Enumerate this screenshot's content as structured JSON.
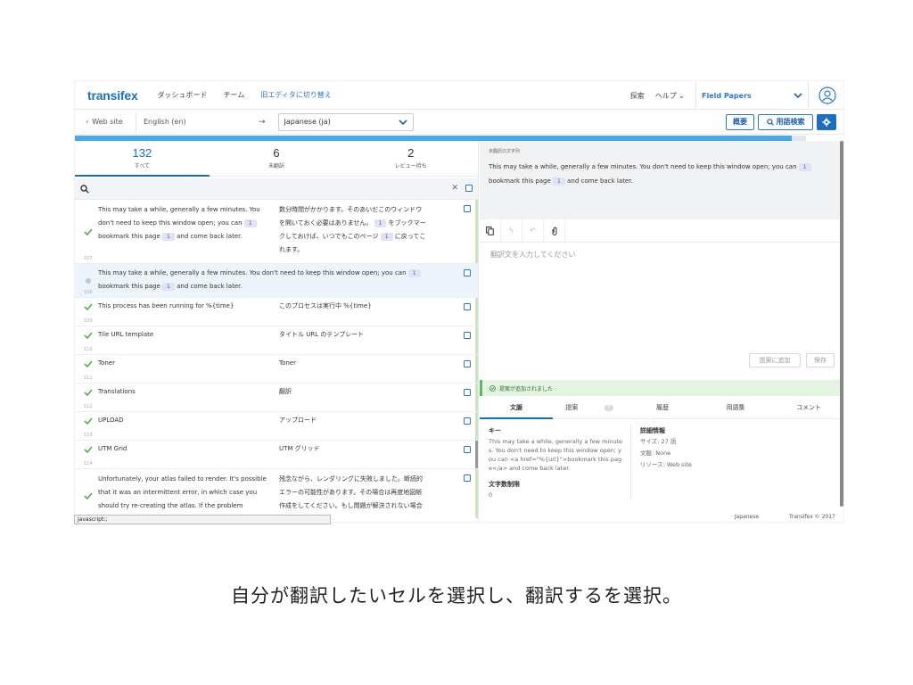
{
  "nav": {
    "logo": "transifex",
    "links": [
      "ダッシュボード",
      "チーム"
    ],
    "legacy_editor": "旧エディタに切り替え",
    "search": "探索",
    "help": "ヘルプ",
    "project": "Field Papers"
  },
  "subnav": {
    "back": "Web site",
    "source_lang": "English (en)",
    "arrow": "→",
    "target_lang": "Japanese (ja)",
    "overview": "概要",
    "glossary": "用語検索"
  },
  "progress": {
    "percent": 98
  },
  "stats": [
    {
      "count": "132",
      "label": "すべて"
    },
    {
      "count": "6",
      "label": "未翻訳"
    },
    {
      "count": "2",
      "label": "レビュー待ち"
    }
  ],
  "rows": {
    "r1": {
      "num": "107",
      "src_a": "This may take a while, generally a few minutes. You",
      "src_b": "don't need to keep this window open; you can",
      "src_c": "bookmark this page",
      "src_d": "and come back later.",
      "tag": "1",
      "tgt_a": "数分時間がかかります。そのあいだこのウィンドウ",
      "tgt_b": "を開いておく必要はありません。",
      "tgt_c": "をブックマー",
      "tgt_d": "クしておけば、いつでもこのページ",
      "tgt_e": "に戻ってこ",
      "tgt_f": "れます。"
    },
    "r2": {
      "num": "108",
      "src_a": "This may take a while, generally a few minutes. You don't need to keep this window open; you can",
      "src_b": "bookmark this page",
      "src_c": "and come back later.",
      "tag": "1"
    },
    "r3": {
      "num": "109",
      "src": "This process has been running for %{time}",
      "tgt": "このプロセスは実行中 %{time}"
    },
    "r4": {
      "num": "110",
      "src": "Tile URL template",
      "tgt": "タイトル URL のテンプレート"
    },
    "r5": {
      "num": "111",
      "src": "Toner",
      "tgt": "Toner"
    },
    "r6": {
      "num": "112",
      "src": "Translations",
      "tgt": "翻訳"
    },
    "r7": {
      "num": "113",
      "src": "UPLOAD",
      "tgt": "アップロード"
    },
    "r8": {
      "num": "114",
      "src": "UTM Grid",
      "tgt": "UTM グリッド"
    },
    "r9": {
      "src_a": "Unfortunately, your atlas failed to render. It's possible",
      "src_b": "that it was an intermittent error, in which case you",
      "src_c": "should try re-creating the atlas. If the problem",
      "tgt_a": "残念ながら、レンダリングに失敗しました。断続的",
      "tgt_b": "エラーの可能性があります。その場合は再度地図帳",
      "tgt_c": "作成をしてください。もし問題が解決されない場合"
    }
  },
  "right": {
    "source_heading": "未翻訳の文字列",
    "source_a": "This may take a while, generally a few minutes. You don't need to keep this window open; you can",
    "source_b": "bookmark this page",
    "source_c": "and come back later.",
    "tag": "1",
    "placeholder": "翻訳文を入力してください",
    "add_suggestion": "提案に追加",
    "save": "保存",
    "notice": "提案が追加されました",
    "tabs": [
      "文脈",
      "提案",
      "履歴",
      "用語集",
      "コメント"
    ],
    "suggest_count": "0",
    "key_label": "キー",
    "key_value": "This may take a while, generally a few minutes. You don't need to keep this window open; you can <a href=\"%{url}\">bookmark this page</a> and come back later.",
    "charlimit_label": "文字数制限",
    "charlimit_value": "0",
    "details_label": "詳細情報",
    "size": "サイズ:  27 語",
    "context": "文脈: None",
    "resource": "リソース:  Web site"
  },
  "footer": {
    "status_url": "javascript:;",
    "lang": "· Japanese",
    "copyright": "Transifex © 2017"
  },
  "caption": "自分が翻訳したいセルを選択し、翻訳するを選択。"
}
